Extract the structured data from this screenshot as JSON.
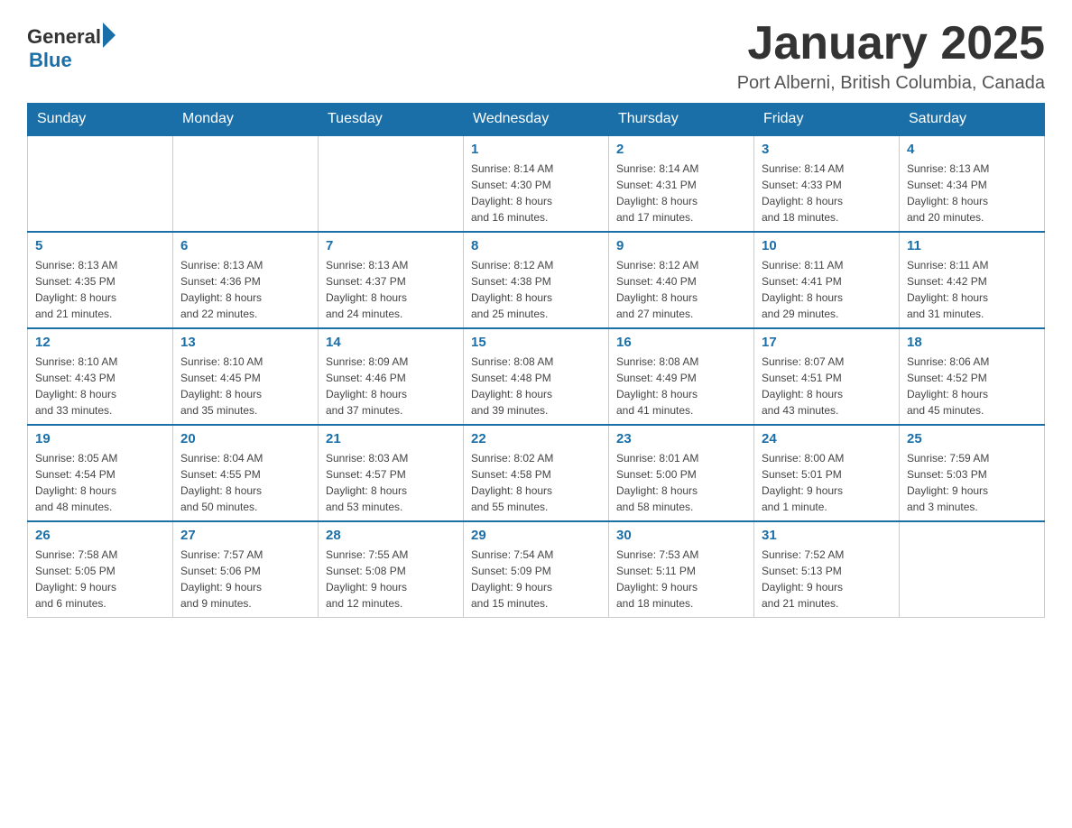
{
  "header": {
    "logo_general": "General",
    "logo_blue": "Blue",
    "title": "January 2025",
    "subtitle": "Port Alberni, British Columbia, Canada"
  },
  "days_of_week": [
    "Sunday",
    "Monday",
    "Tuesday",
    "Wednesday",
    "Thursday",
    "Friday",
    "Saturday"
  ],
  "weeks": [
    {
      "days": [
        {
          "num": "",
          "info": ""
        },
        {
          "num": "",
          "info": ""
        },
        {
          "num": "",
          "info": ""
        },
        {
          "num": "1",
          "info": "Sunrise: 8:14 AM\nSunset: 4:30 PM\nDaylight: 8 hours\nand 16 minutes."
        },
        {
          "num": "2",
          "info": "Sunrise: 8:14 AM\nSunset: 4:31 PM\nDaylight: 8 hours\nand 17 minutes."
        },
        {
          "num": "3",
          "info": "Sunrise: 8:14 AM\nSunset: 4:33 PM\nDaylight: 8 hours\nand 18 minutes."
        },
        {
          "num": "4",
          "info": "Sunrise: 8:13 AM\nSunset: 4:34 PM\nDaylight: 8 hours\nand 20 minutes."
        }
      ]
    },
    {
      "days": [
        {
          "num": "5",
          "info": "Sunrise: 8:13 AM\nSunset: 4:35 PM\nDaylight: 8 hours\nand 21 minutes."
        },
        {
          "num": "6",
          "info": "Sunrise: 8:13 AM\nSunset: 4:36 PM\nDaylight: 8 hours\nand 22 minutes."
        },
        {
          "num": "7",
          "info": "Sunrise: 8:13 AM\nSunset: 4:37 PM\nDaylight: 8 hours\nand 24 minutes."
        },
        {
          "num": "8",
          "info": "Sunrise: 8:12 AM\nSunset: 4:38 PM\nDaylight: 8 hours\nand 25 minutes."
        },
        {
          "num": "9",
          "info": "Sunrise: 8:12 AM\nSunset: 4:40 PM\nDaylight: 8 hours\nand 27 minutes."
        },
        {
          "num": "10",
          "info": "Sunrise: 8:11 AM\nSunset: 4:41 PM\nDaylight: 8 hours\nand 29 minutes."
        },
        {
          "num": "11",
          "info": "Sunrise: 8:11 AM\nSunset: 4:42 PM\nDaylight: 8 hours\nand 31 minutes."
        }
      ]
    },
    {
      "days": [
        {
          "num": "12",
          "info": "Sunrise: 8:10 AM\nSunset: 4:43 PM\nDaylight: 8 hours\nand 33 minutes."
        },
        {
          "num": "13",
          "info": "Sunrise: 8:10 AM\nSunset: 4:45 PM\nDaylight: 8 hours\nand 35 minutes."
        },
        {
          "num": "14",
          "info": "Sunrise: 8:09 AM\nSunset: 4:46 PM\nDaylight: 8 hours\nand 37 minutes."
        },
        {
          "num": "15",
          "info": "Sunrise: 8:08 AM\nSunset: 4:48 PM\nDaylight: 8 hours\nand 39 minutes."
        },
        {
          "num": "16",
          "info": "Sunrise: 8:08 AM\nSunset: 4:49 PM\nDaylight: 8 hours\nand 41 minutes."
        },
        {
          "num": "17",
          "info": "Sunrise: 8:07 AM\nSunset: 4:51 PM\nDaylight: 8 hours\nand 43 minutes."
        },
        {
          "num": "18",
          "info": "Sunrise: 8:06 AM\nSunset: 4:52 PM\nDaylight: 8 hours\nand 45 minutes."
        }
      ]
    },
    {
      "days": [
        {
          "num": "19",
          "info": "Sunrise: 8:05 AM\nSunset: 4:54 PM\nDaylight: 8 hours\nand 48 minutes."
        },
        {
          "num": "20",
          "info": "Sunrise: 8:04 AM\nSunset: 4:55 PM\nDaylight: 8 hours\nand 50 minutes."
        },
        {
          "num": "21",
          "info": "Sunrise: 8:03 AM\nSunset: 4:57 PM\nDaylight: 8 hours\nand 53 minutes."
        },
        {
          "num": "22",
          "info": "Sunrise: 8:02 AM\nSunset: 4:58 PM\nDaylight: 8 hours\nand 55 minutes."
        },
        {
          "num": "23",
          "info": "Sunrise: 8:01 AM\nSunset: 5:00 PM\nDaylight: 8 hours\nand 58 minutes."
        },
        {
          "num": "24",
          "info": "Sunrise: 8:00 AM\nSunset: 5:01 PM\nDaylight: 9 hours\nand 1 minute."
        },
        {
          "num": "25",
          "info": "Sunrise: 7:59 AM\nSunset: 5:03 PM\nDaylight: 9 hours\nand 3 minutes."
        }
      ]
    },
    {
      "days": [
        {
          "num": "26",
          "info": "Sunrise: 7:58 AM\nSunset: 5:05 PM\nDaylight: 9 hours\nand 6 minutes."
        },
        {
          "num": "27",
          "info": "Sunrise: 7:57 AM\nSunset: 5:06 PM\nDaylight: 9 hours\nand 9 minutes."
        },
        {
          "num": "28",
          "info": "Sunrise: 7:55 AM\nSunset: 5:08 PM\nDaylight: 9 hours\nand 12 minutes."
        },
        {
          "num": "29",
          "info": "Sunrise: 7:54 AM\nSunset: 5:09 PM\nDaylight: 9 hours\nand 15 minutes."
        },
        {
          "num": "30",
          "info": "Sunrise: 7:53 AM\nSunset: 5:11 PM\nDaylight: 9 hours\nand 18 minutes."
        },
        {
          "num": "31",
          "info": "Sunrise: 7:52 AM\nSunset: 5:13 PM\nDaylight: 9 hours\nand 21 minutes."
        },
        {
          "num": "",
          "info": ""
        }
      ]
    }
  ]
}
